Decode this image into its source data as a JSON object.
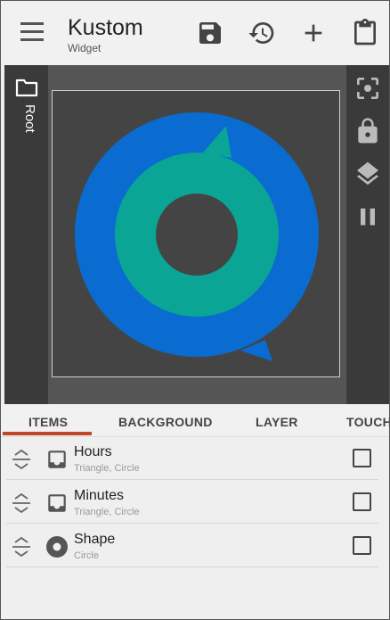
{
  "app": {
    "title": "Kustom",
    "subtitle": "Widget"
  },
  "toolbar": {
    "icons": [
      "menu-icon",
      "save-icon",
      "history-icon",
      "add-icon",
      "clipboard-icon"
    ]
  },
  "editor": {
    "root_label": "Root",
    "rail_icons": [
      "focus-icon",
      "lock-icon",
      "layers-icon",
      "pause-icon"
    ],
    "colors": {
      "outer_ring": "#0a6bd1",
      "inner_ring": "#0aa594",
      "canvas": "#444444"
    }
  },
  "tabs": [
    {
      "label": "ITEMS",
      "active": true
    },
    {
      "label": "BACKGROUND",
      "active": false
    },
    {
      "label": "LAYER",
      "active": false
    },
    {
      "label": "TOUCH",
      "active": false
    }
  ],
  "items": [
    {
      "title": "Hours",
      "subtitle": "Triangle, Circle",
      "icon": "stack-icon",
      "checked": false
    },
    {
      "title": "Minutes",
      "subtitle": "Triangle, Circle",
      "icon": "stack-icon",
      "checked": false
    },
    {
      "title": "Shape",
      "subtitle": "Circle",
      "icon": "shape-icon",
      "checked": false
    }
  ],
  "accent": "#c0472a"
}
